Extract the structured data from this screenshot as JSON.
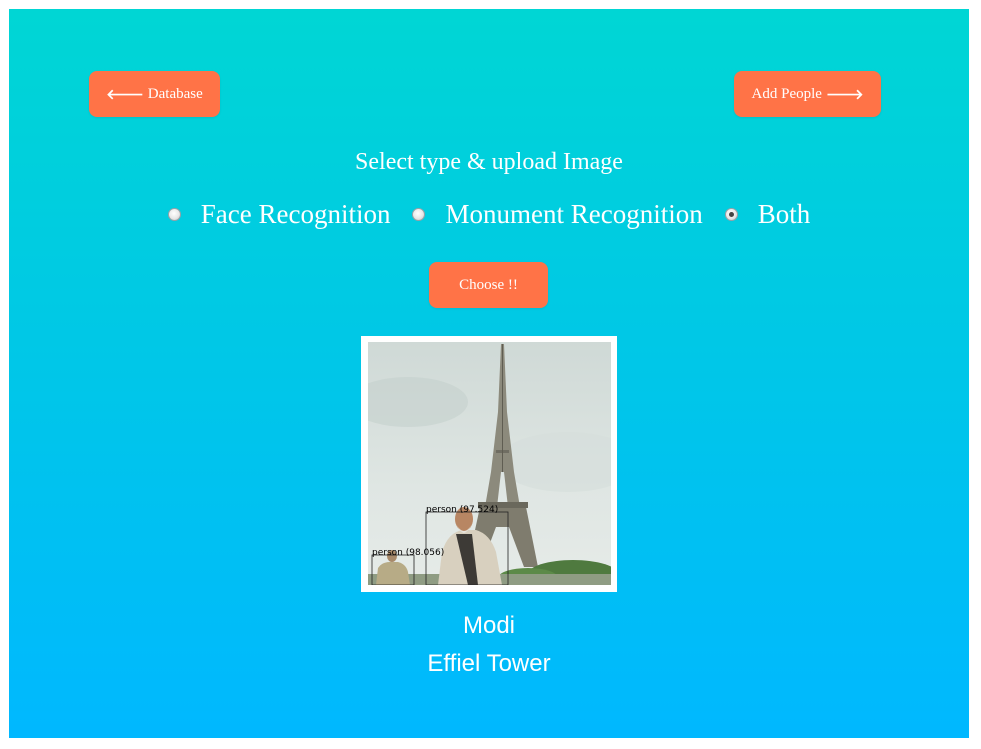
{
  "nav": {
    "database_label": "Database",
    "add_people_label": "Add People"
  },
  "main": {
    "title": "Select type & upload Image",
    "options": [
      {
        "label": "Face Recognition",
        "checked": false
      },
      {
        "label": "Monument Recognition",
        "checked": false
      },
      {
        "label": "Both",
        "checked": true
      }
    ],
    "choose_label": "Choose !!"
  },
  "photo": {
    "detections": [
      {
        "label": "person (97.524)"
      },
      {
        "label": "person (98.056)"
      }
    ]
  },
  "results": {
    "face": "Modi",
    "monument": "Effiel Tower"
  },
  "colors": {
    "button": "#ff7347",
    "gradient_top": "#00d6d4",
    "gradient_bottom": "#00b8ff"
  }
}
